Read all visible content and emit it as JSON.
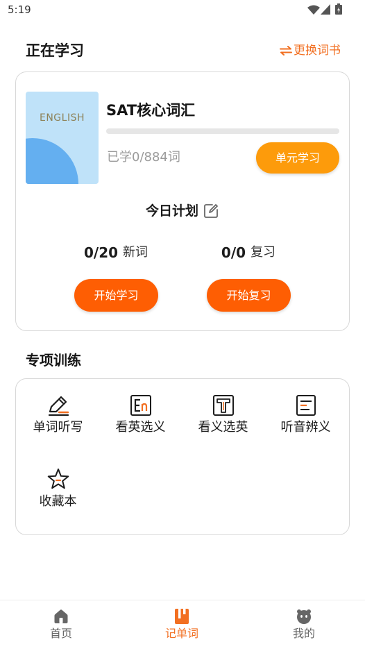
{
  "status_bar": {
    "time": "5:19",
    "icons": [
      "wifi-icon",
      "signal-icon",
      "battery-icon"
    ]
  },
  "header": {
    "title": "正在学习",
    "change_book": {
      "icon": "swap-icon",
      "label": "更换词书"
    }
  },
  "current_book": {
    "cover_text": "ENGLISH",
    "name": "SAT核心词汇",
    "progress": 0,
    "learned_text": "已学0/884词",
    "unit_button": "单元学习"
  },
  "plan": {
    "title": "今日计划",
    "edit_icon": "edit-icon",
    "new_words": {
      "count": "0/20",
      "label": "新词"
    },
    "review": {
      "count": "0/0",
      "label": "复习"
    },
    "start_learn_button": "开始学习",
    "start_review_button": "开始复习"
  },
  "training": {
    "title": "专项训练",
    "items": [
      {
        "label": "单词听写",
        "icon": "pencil-icon"
      },
      {
        "label": "看英选义",
        "icon": "en-letters-icon"
      },
      {
        "label": "看义选英",
        "icon": "letter-t-icon"
      },
      {
        "label": "听音辨义",
        "icon": "document-lines-icon"
      },
      {
        "label": "收藏本",
        "icon": "star-icon"
      }
    ]
  },
  "bottom_nav": {
    "items": [
      {
        "label": "首页",
        "icon": "home-icon",
        "active": false
      },
      {
        "label": "记单词",
        "icon": "notebook-icon",
        "active": true
      },
      {
        "label": "我的",
        "icon": "face-icon",
        "active": false
      }
    ]
  },
  "colors": {
    "accent": "#f26f21",
    "unit_button": "#fd9b0b",
    "start_button": "#fe5e03",
    "cover_bg": "#bfe2f9",
    "cover_shape": "#64aff0",
    "nav_inactive": "#666666"
  }
}
